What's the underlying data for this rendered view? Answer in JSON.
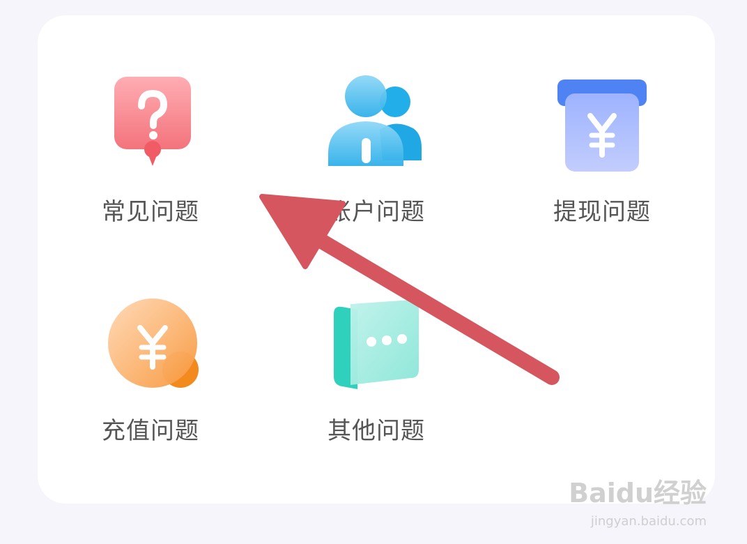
{
  "help_categories": [
    {
      "label": "常见问题",
      "icon": "question-bubble-icon"
    },
    {
      "label": "账户问题",
      "icon": "users-icon"
    },
    {
      "label": "提现问题",
      "icon": "withdraw-icon"
    },
    {
      "label": "充值问题",
      "icon": "recharge-coin-icon"
    },
    {
      "label": "其他问题",
      "icon": "chat-book-icon"
    }
  ],
  "colors": {
    "background": "#f5f5fb",
    "card": "#ffffff",
    "label": "#555555",
    "arrow": "#d5565e",
    "question_icon": "#f47b84",
    "users_icon": "#35b8ef",
    "withdraw_icon": "#5b86f2",
    "recharge_icon": "#f7a048",
    "chat_icon": "#3fd6c3"
  },
  "watermark": {
    "brand": "Baidu经验",
    "url": "jingyan.baidu.com"
  }
}
